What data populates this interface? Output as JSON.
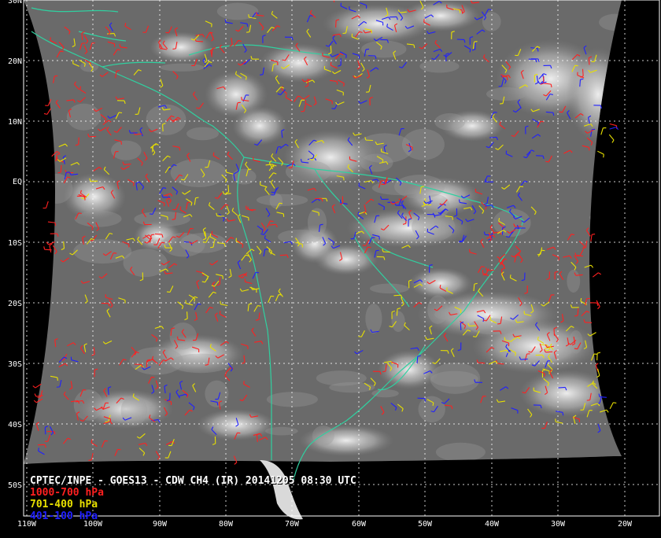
{
  "map": {
    "product_title": "CPTEC/INPE - GOES13 - CDW CH4 (IR) 20141205 08:30 UTC",
    "legend": [
      {
        "label": "1000-700 hPa",
        "color": "#ff2020"
      },
      {
        "label": "701-400 hPa",
        "color": "#e8e000"
      },
      {
        "label": "401-100 hPa",
        "color": "#2020ff"
      }
    ],
    "coastline_color": "#30d0a0",
    "grid_color": "#ffffff",
    "latitude_labels": [
      "30N",
      "20N",
      "10N",
      "EQ",
      "10S",
      "20S",
      "30S",
      "40S",
      "50S"
    ],
    "longitude_labels": [
      "110W",
      "100W",
      "90W",
      "80W",
      "70W",
      "60W",
      "50W",
      "40W",
      "30W",
      "20W"
    ]
  }
}
